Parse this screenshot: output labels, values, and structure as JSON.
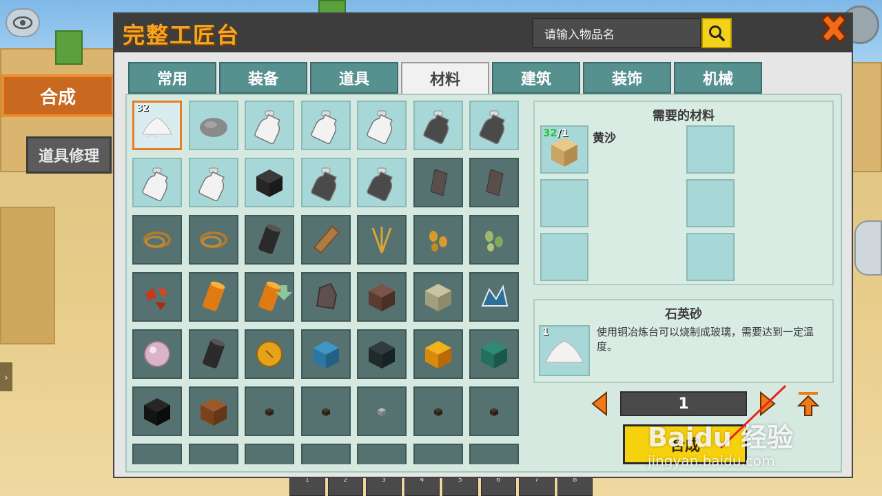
{
  "panel": {
    "title": "完整工匠台",
    "search_placeholder": "请输入物品名"
  },
  "side_tabs": [
    {
      "label": "合成",
      "active": true
    },
    {
      "label": "道具修理",
      "active": false
    }
  ],
  "tabs": [
    {
      "label": "常用",
      "active": false
    },
    {
      "label": "装备",
      "active": false
    },
    {
      "label": "道具",
      "active": false
    },
    {
      "label": "材料",
      "active": true
    },
    {
      "label": "建筑",
      "active": false
    },
    {
      "label": "装饰",
      "active": false
    },
    {
      "label": "机械",
      "active": false
    }
  ],
  "grid": [
    {
      "icon": "sand-pile-icon",
      "style": "sel",
      "count": "32"
    },
    {
      "icon": "stone-icon",
      "style": "light"
    },
    {
      "icon": "bottle-icon",
      "style": "light"
    },
    {
      "icon": "bottle-icon",
      "style": "light"
    },
    {
      "icon": "bottle-icon",
      "style": "light"
    },
    {
      "icon": "dark-bottle-icon",
      "style": "light"
    },
    {
      "icon": "dark-bottle-icon",
      "style": "light"
    },
    {
      "icon": "bottle-icon",
      "style": "light"
    },
    {
      "icon": "bottle-icon",
      "style": "light"
    },
    {
      "icon": "coal-block-icon",
      "style": "light"
    },
    {
      "icon": "dark-bottle-icon",
      "style": "light"
    },
    {
      "icon": "dark-bottle-icon",
      "style": "light"
    },
    {
      "icon": "flint-icon",
      "style": "dark"
    },
    {
      "icon": "flint-icon",
      "style": "dark"
    },
    {
      "icon": "rope-icon",
      "style": "dark"
    },
    {
      "icon": "rope-icon",
      "style": "dark"
    },
    {
      "icon": "black-cylinder-icon",
      "style": "dark"
    },
    {
      "icon": "wood-plank-icon",
      "style": "dark"
    },
    {
      "icon": "wheat-icon",
      "style": "dark"
    },
    {
      "icon": "seeds-icon",
      "style": "dark"
    },
    {
      "icon": "green-seeds-icon",
      "style": "dark"
    },
    {
      "icon": "red-ore-icon",
      "style": "dark"
    },
    {
      "icon": "orange-cylinder-icon",
      "style": "dark"
    },
    {
      "icon": "orange-cylinder-icon",
      "style": "dark"
    },
    {
      "icon": "rock-icon",
      "style": "dark"
    },
    {
      "icon": "brown-block-icon",
      "style": "dark"
    },
    {
      "icon": "mossy-block-icon",
      "style": "dark"
    },
    {
      "icon": "blue-crystal-icon",
      "style": "dark"
    },
    {
      "icon": "pearl-icon",
      "style": "dark"
    },
    {
      "icon": "black-cylinder-icon",
      "style": "dark"
    },
    {
      "icon": "amber-icon",
      "style": "dark"
    },
    {
      "icon": "blue-block-icon",
      "style": "dark"
    },
    {
      "icon": "dark-block-icon",
      "style": "dark"
    },
    {
      "icon": "lava-block-icon",
      "style": "dark"
    },
    {
      "icon": "teal-block-icon",
      "style": "dark"
    },
    {
      "icon": "black-block-icon",
      "style": "dark"
    },
    {
      "icon": "rusty-block-icon",
      "style": "dark"
    },
    {
      "icon": "small-cube-icon",
      "style": "dark"
    },
    {
      "icon": "small-cube-icon",
      "style": "dark"
    },
    {
      "icon": "gray-small-cube-icon",
      "style": "dark"
    },
    {
      "icon": "small-cube-icon",
      "style": "dark"
    },
    {
      "icon": "small-cube-icon",
      "style": "dark"
    },
    {
      "icon": "partial-item-icon",
      "style": "dark"
    },
    {
      "icon": "partial-item-icon",
      "style": "dark"
    },
    {
      "icon": "partial-item-icon",
      "style": "dark"
    },
    {
      "icon": "banana-icon",
      "style": "dark"
    },
    {
      "icon": "spiky-item-icon",
      "style": "dark"
    },
    {
      "icon": "glow-item-icon",
      "style": "dark"
    },
    {
      "icon": "partial-item-icon",
      "style": "dark"
    }
  ],
  "materials": {
    "title": "需要的材料",
    "items": [
      {
        "name": "黄沙",
        "have": "32",
        "need": "/1",
        "icon": "sand-block-icon"
      }
    ]
  },
  "result": {
    "name": "石英砂",
    "count": "1",
    "description": "使用铜冶炼台可以烧制成玻璃，需要达到一定温度。",
    "icon": "sand-pile-icon"
  },
  "quantity": "1",
  "craft_label": "合成",
  "hotbar": [
    "1",
    "2",
    "3",
    "4",
    "5",
    "6",
    "7",
    "8"
  ],
  "watermark": {
    "brand": "Baidu 经验",
    "url": "jingyan.baidu.com"
  },
  "colors": {
    "accent": "#f5a623",
    "tab": "#56908f",
    "craft": "#f6d20e",
    "slot_light": "#a7d8d7",
    "slot_dark": "#557271"
  }
}
